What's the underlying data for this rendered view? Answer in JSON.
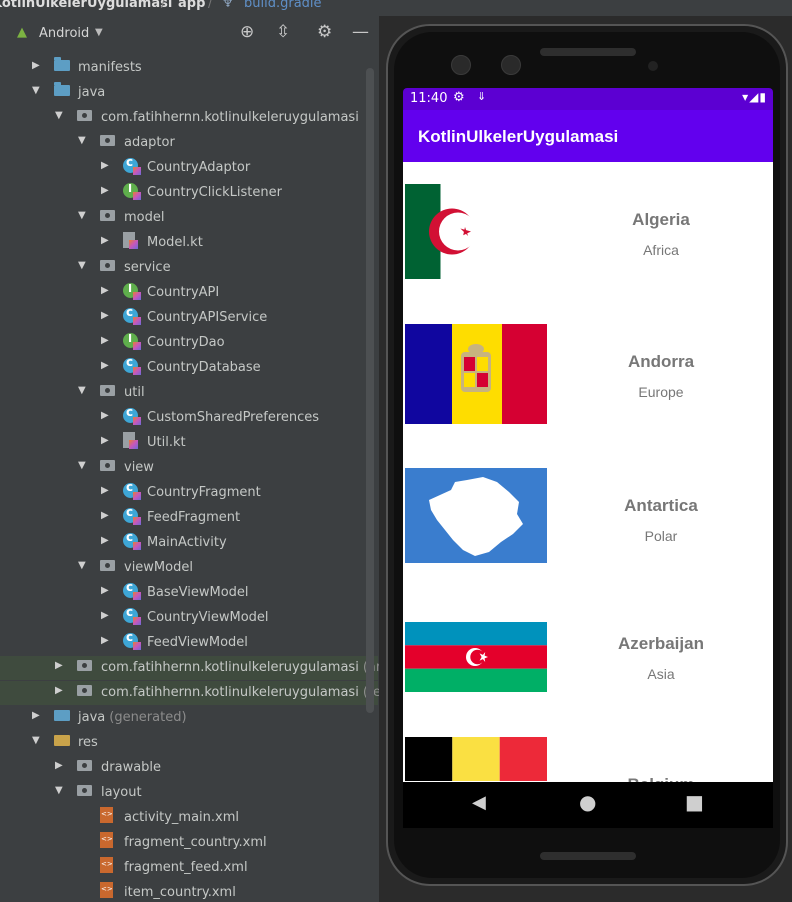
{
  "breadcrumb": {
    "project": "KotlinUlkelerUygulamasi",
    "module": "app",
    "file": "build.gradle"
  },
  "project_panel": {
    "view_mode": "Android",
    "toolbar_icons": [
      "locate-icon",
      "collapse-icon",
      "gear-icon",
      "minimize-icon"
    ],
    "tree": [
      {
        "label": "manifests",
        "type": "folder",
        "depth": 1,
        "expanded": false
      },
      {
        "label": "java",
        "type": "folder",
        "depth": 1,
        "expanded": true
      },
      {
        "label": "com.fatihhernn.kotlinulkeleruygulamasi",
        "type": "package",
        "depth": 2,
        "expanded": true
      },
      {
        "label": "adaptor",
        "type": "package",
        "depth": 3,
        "expanded": true
      },
      {
        "label": "CountryAdaptor",
        "type": "kotlin-class",
        "depth": 4
      },
      {
        "label": "CountryClickListener",
        "type": "kotlin-interface",
        "depth": 4
      },
      {
        "label": "model",
        "type": "package",
        "depth": 3,
        "expanded": true
      },
      {
        "label": "Model.kt",
        "type": "kotlin-file",
        "depth": 4
      },
      {
        "label": "service",
        "type": "package",
        "depth": 3,
        "expanded": true
      },
      {
        "label": "CountryAPI",
        "type": "kotlin-interface",
        "depth": 4
      },
      {
        "label": "CountryAPIService",
        "type": "kotlin-class",
        "depth": 4
      },
      {
        "label": "CountryDao",
        "type": "kotlin-interface",
        "depth": 4
      },
      {
        "label": "CountryDatabase",
        "type": "kotlin-class",
        "depth": 4
      },
      {
        "label": "util",
        "type": "package",
        "depth": 3,
        "expanded": true
      },
      {
        "label": "CustomSharedPreferences",
        "type": "kotlin-class",
        "depth": 4
      },
      {
        "label": "Util.kt",
        "type": "kotlin-file",
        "depth": 4
      },
      {
        "label": "view",
        "type": "package",
        "depth": 3,
        "expanded": true
      },
      {
        "label": "CountryFragment",
        "type": "kotlin-class",
        "depth": 4
      },
      {
        "label": "FeedFragment",
        "type": "kotlin-class",
        "depth": 4
      },
      {
        "label": "MainActivity",
        "type": "kotlin-class",
        "depth": 4
      },
      {
        "label": "viewModel",
        "type": "package",
        "depth": 3,
        "expanded": true
      },
      {
        "label": "BaseViewModel",
        "type": "kotlin-class",
        "depth": 4
      },
      {
        "label": "CountryViewModel",
        "type": "kotlin-class",
        "depth": 4
      },
      {
        "label": "FeedViewModel",
        "type": "kotlin-class",
        "depth": 4
      },
      {
        "label": "com.fatihhernn.kotlinulkeleruygulamasi",
        "suffix": "(andro",
        "type": "package",
        "depth": 2,
        "expanded": false,
        "highlight": true
      },
      {
        "label": "com.fatihhernn.kotlinulkeleruygulamasi",
        "suffix": "(test)",
        "type": "package",
        "depth": 2,
        "expanded": false,
        "highlight": true
      },
      {
        "label": "java",
        "suffix": "(generated)",
        "type": "gen-folder",
        "depth": 1,
        "expanded": false
      },
      {
        "label": "res",
        "type": "res-folder",
        "depth": 1,
        "expanded": true
      },
      {
        "label": "drawable",
        "type": "package",
        "depth": 2,
        "expanded": false
      },
      {
        "label": "layout",
        "type": "package",
        "depth": 2,
        "expanded": true
      },
      {
        "label": "activity_main.xml",
        "type": "xml",
        "depth": 3
      },
      {
        "label": "fragment_country.xml",
        "type": "xml",
        "depth": 3
      },
      {
        "label": "fragment_feed.xml",
        "type": "xml",
        "depth": 3
      },
      {
        "label": "item_country.xml",
        "type": "xml",
        "depth": 3
      }
    ]
  },
  "phone": {
    "status_time": "11:40",
    "app_title": "KotlinUlkelerUygulamasi",
    "countries": [
      {
        "name": "Algeria",
        "region": "Africa",
        "flag": "algeria"
      },
      {
        "name": "Andorra",
        "region": "Europe",
        "flag": "andorra"
      },
      {
        "name": "Antartica",
        "region": "Polar",
        "flag": "antarctica"
      },
      {
        "name": "Azerbaijan",
        "region": "Asia",
        "flag": "azerbaijan"
      },
      {
        "name": "Belgium",
        "region": "",
        "flag": "belgium"
      }
    ],
    "colors": {
      "status_bar": "#5c00d2",
      "app_bar": "#6200ee"
    }
  }
}
